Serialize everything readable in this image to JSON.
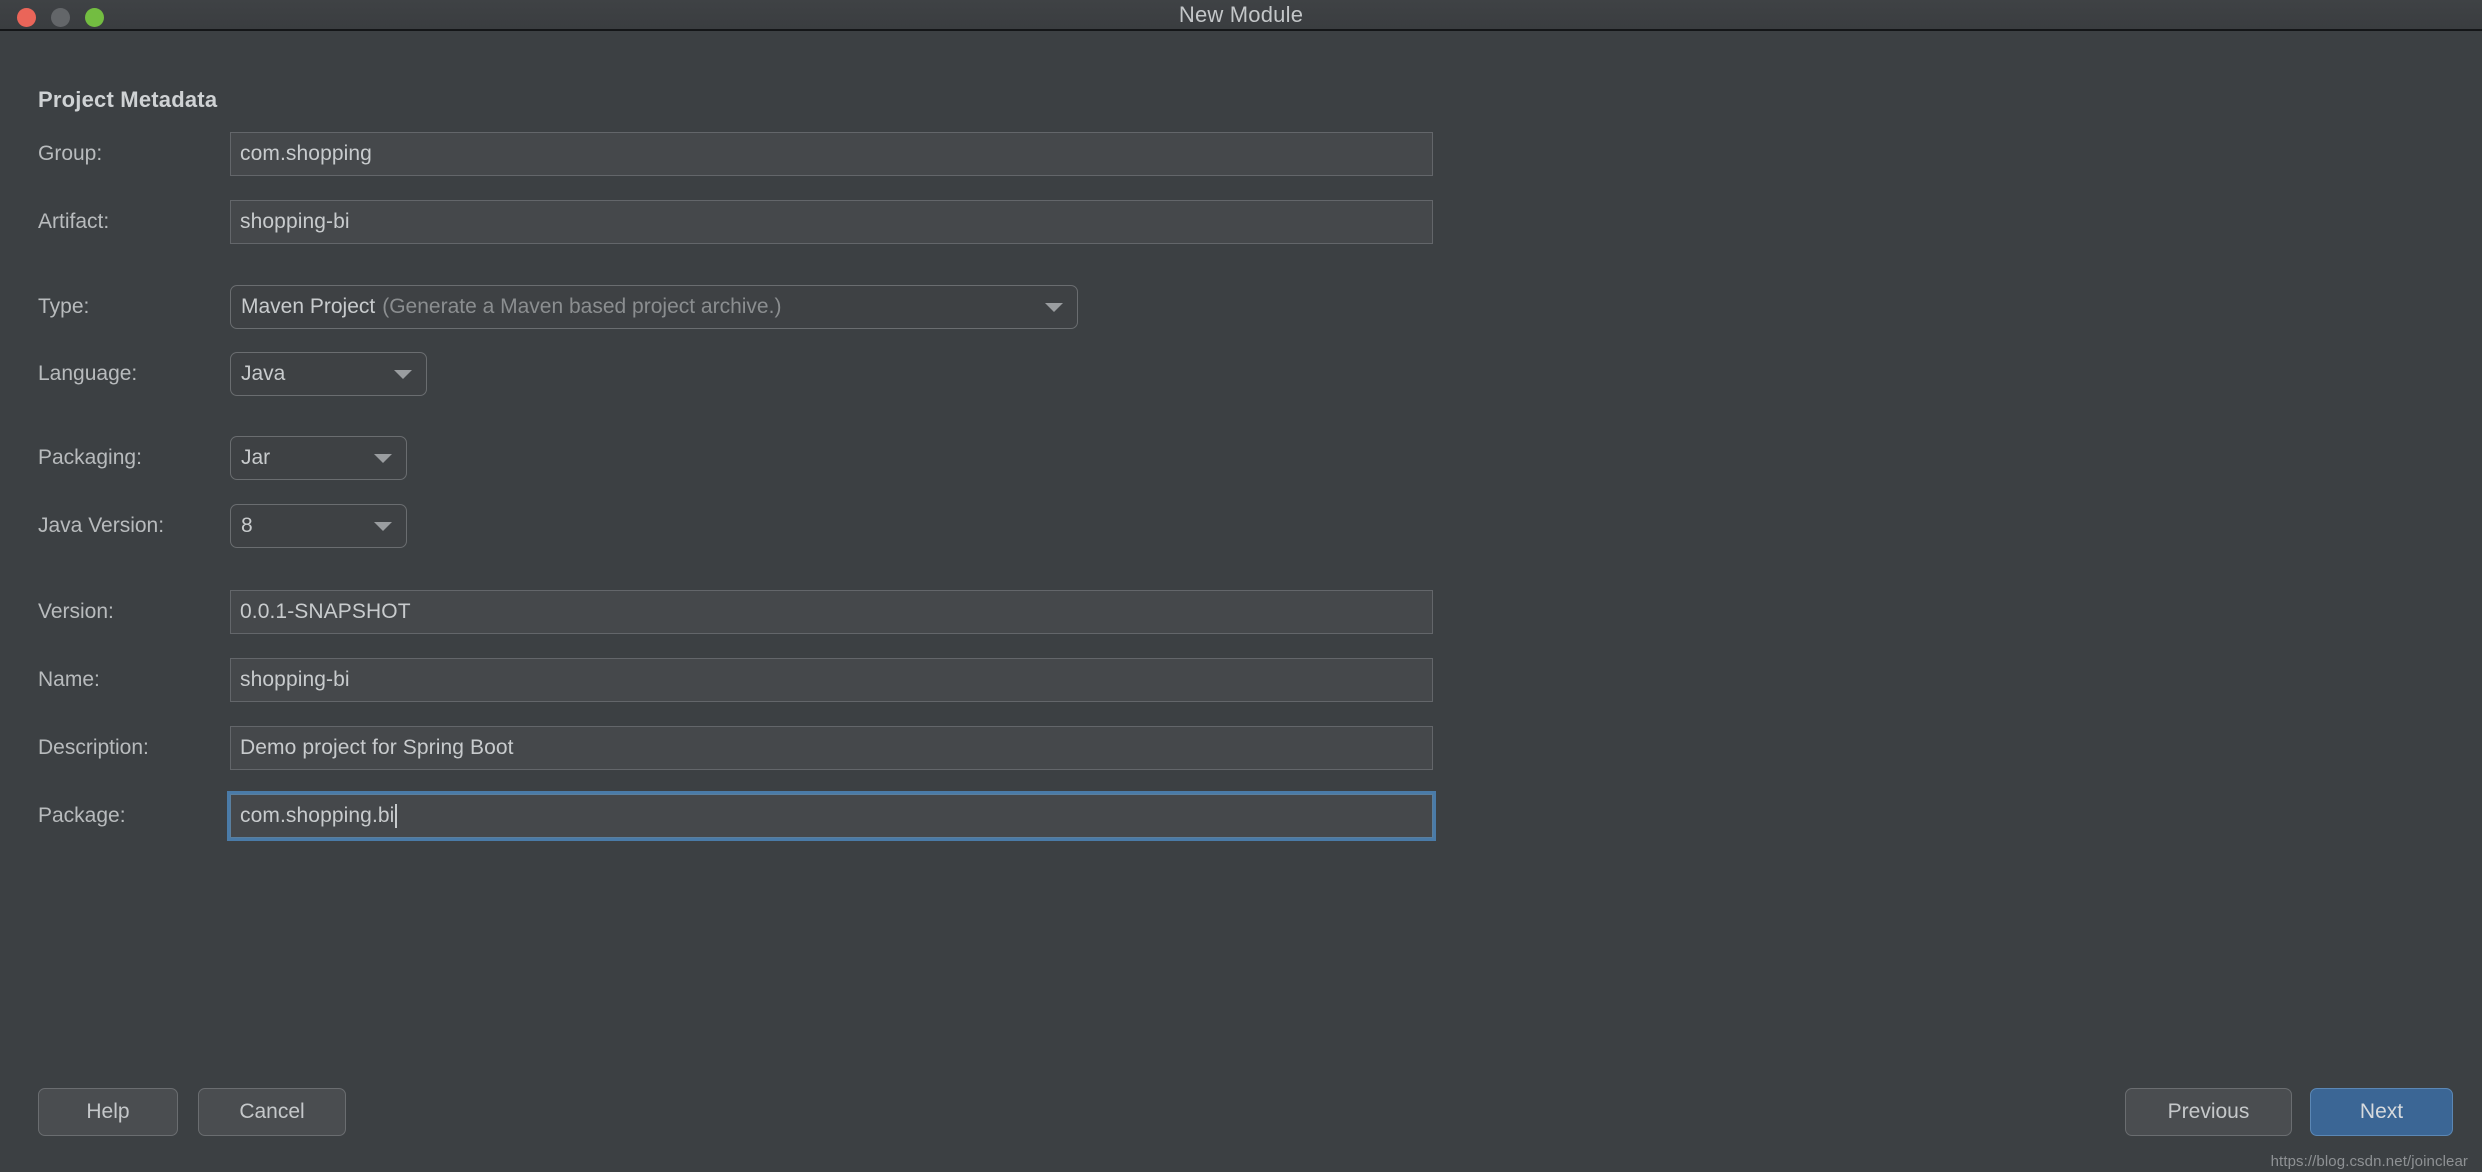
{
  "window": {
    "title": "New Module",
    "traffic_lights": [
      {
        "name": "close-button",
        "color": "#ea6559"
      },
      {
        "name": "minimize-button",
        "color": "#636669"
      },
      {
        "name": "maximize-button",
        "color": "#73bd41"
      }
    ]
  },
  "form": {
    "section_title": "Project Metadata",
    "fields": {
      "group": {
        "label": "Group:",
        "value": "com.shopping"
      },
      "artifact": {
        "label": "Artifact:",
        "value": "shopping-bi"
      },
      "type": {
        "label": "Type:",
        "value": "Maven Project",
        "hint": "(Generate a Maven based project archive.)"
      },
      "language": {
        "label": "Language:",
        "value": "Java"
      },
      "packaging": {
        "label": "Packaging:",
        "value": "Jar"
      },
      "java_version": {
        "label": "Java Version:",
        "value": "8"
      },
      "version": {
        "label": "Version:",
        "value": "0.0.1-SNAPSHOT"
      },
      "name": {
        "label": "Name:",
        "value": "shopping-bi"
      },
      "description": {
        "label": "Description:",
        "value": "Demo project for Spring Boot"
      },
      "package": {
        "label": "Package:",
        "value": "com.shopping.bi",
        "focused": true
      }
    }
  },
  "footer": {
    "help_label": "Help",
    "cancel_label": "Cancel",
    "previous_label": "Previous",
    "next_label": "Next"
  },
  "watermark": "https://blog.csdn.net/joinclear",
  "colors": {
    "background": "#3c4043",
    "field_bg": "#45484b",
    "field_border": "#63666a",
    "focus_blue": "#4a7ba8",
    "primary_button": "#3b6695",
    "text": "#c8cbcd",
    "muted_text": "#8b8e90"
  }
}
